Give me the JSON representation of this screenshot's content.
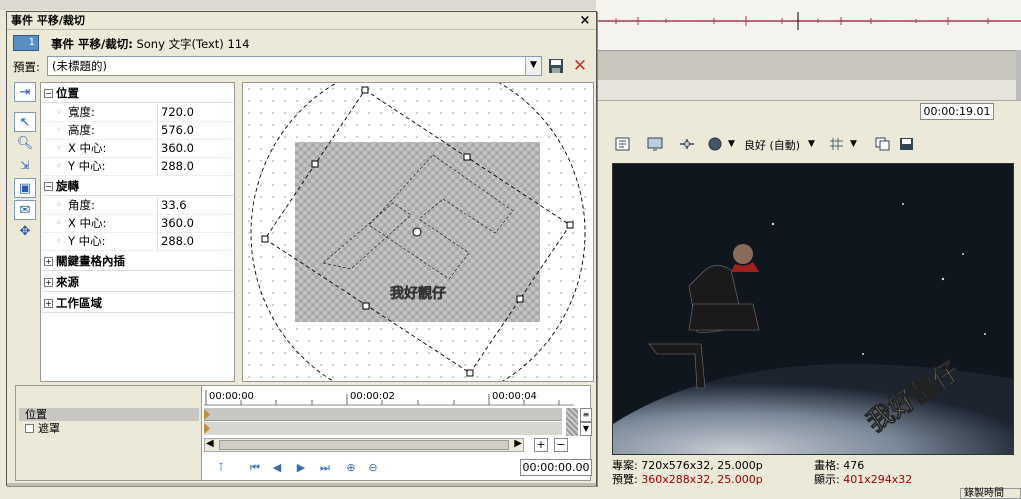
{
  "background": {
    "timecode": "00:00:19.01",
    "quality": "良好 (自動)",
    "video_caption": "我好靚仔",
    "stats": {
      "project_label": "專案:",
      "project_value": "720x576x32, 25.000p",
      "preview_label": "預覽:",
      "preview_value": "360x288x32, 25.000p",
      "frame_label": "畫格:",
      "frame_value": "476",
      "display_label": "顯示:",
      "display_value": "401x294x32"
    },
    "bottom_tag": "錄製時間"
  },
  "dialog": {
    "title": "事件 平移/裁切",
    "header_icon_text": "1",
    "header_title": "事件 平移/裁切:",
    "header_subject": "Sony 文字(Text) 114",
    "preset_label": "預置:",
    "preset_value": "(未標題的)",
    "sections": {
      "position": {
        "label": "位置",
        "rows": [
          {
            "key": "寬度:",
            "value": "720.0"
          },
          {
            "key": "高度:",
            "value": "576.0"
          },
          {
            "key": "X 中心:",
            "value": "360.0"
          },
          {
            "key": "Y 中心:",
            "value": "288.0"
          }
        ]
      },
      "rotation": {
        "label": "旋轉",
        "rows": [
          {
            "key": "角度:",
            "value": "33.6"
          },
          {
            "key": "X 中心:",
            "value": "360.0"
          },
          {
            "key": "Y 中心:",
            "value": "288.0"
          }
        ]
      },
      "keyframe": {
        "label": "關鍵畫格內插"
      },
      "source": {
        "label": "來源"
      },
      "workspace": {
        "label": "工作區域"
      }
    },
    "canvas_text": "我好靚仔",
    "timeline": {
      "track_position": "位置",
      "track_mask": "遮罩",
      "ruler": [
        "00:00:00",
        "00:00:02",
        "00:00:04"
      ],
      "time": "00:00:00.00"
    }
  },
  "colors": {
    "accent_blue": "#5b8ec0",
    "stats_red": "#a00000",
    "delete_red": "#c0392b"
  }
}
